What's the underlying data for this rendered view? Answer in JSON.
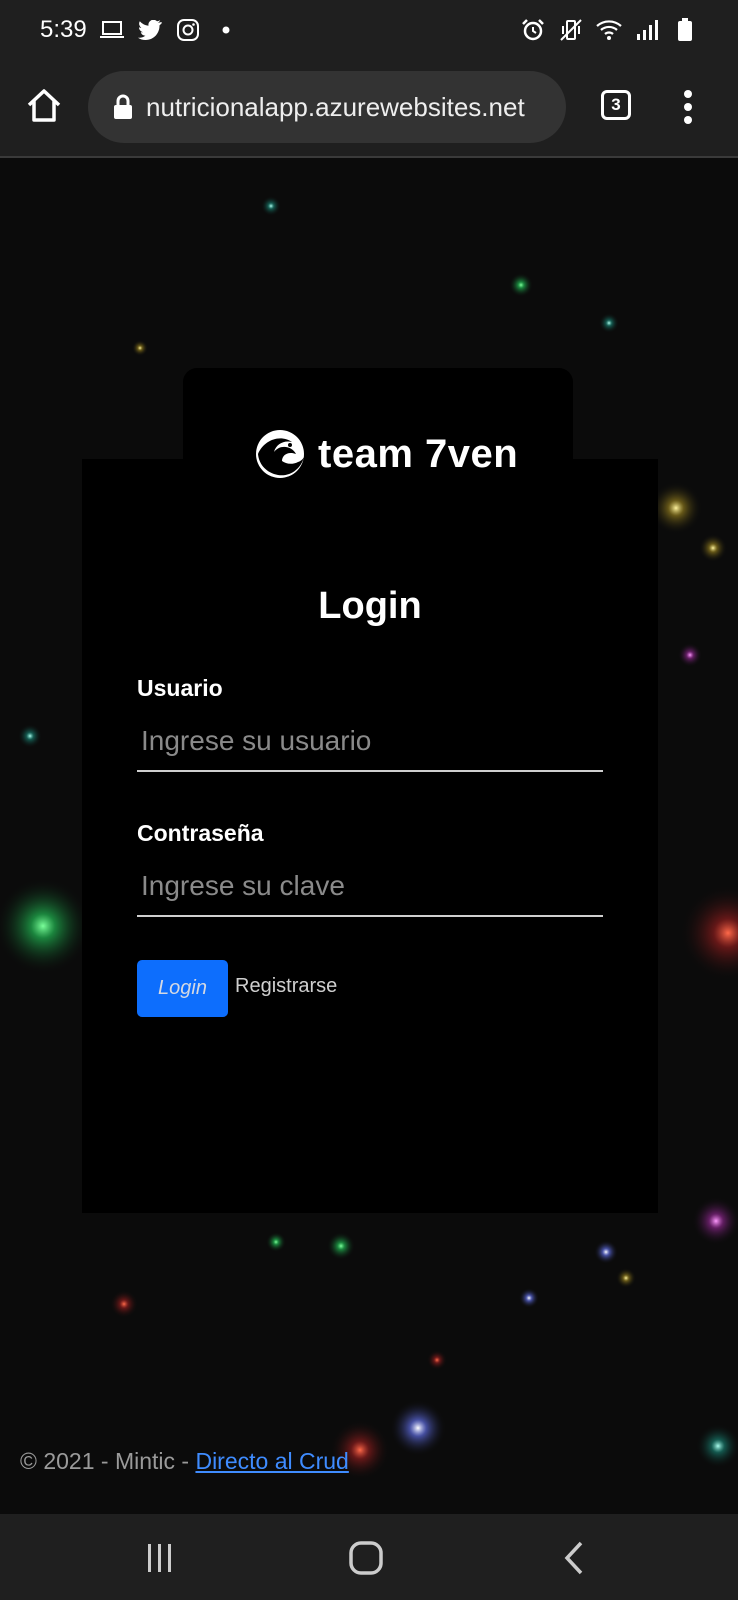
{
  "status_bar": {
    "time": "5:39",
    "left_icons": [
      "laptop-icon",
      "twitter-icon",
      "instagram-icon",
      "dot-icon"
    ],
    "right_icons": [
      "alarm-icon",
      "vibrate-icon",
      "wifi-icon",
      "signal-icon",
      "battery-icon"
    ]
  },
  "browser": {
    "url": "nutricionalapp.azurewebsites.net",
    "tab_count": "3"
  },
  "brand": {
    "logo_text": "team 7ven"
  },
  "login": {
    "title": "Login",
    "username_label": "Usuario",
    "username_placeholder": "Ingrese su usuario",
    "username_value": "",
    "password_label": "Contraseña",
    "password_placeholder": "Ingrese su clave",
    "password_value": "",
    "login_button": "Login",
    "register_link": "Registrarse"
  },
  "footer": {
    "text": "© 2021 - Mintic - ",
    "link_text": "Directo al Crud"
  },
  "colors": {
    "primary_button": "#0d6efd",
    "link": "#3f8cff",
    "card_background": "#000000"
  }
}
